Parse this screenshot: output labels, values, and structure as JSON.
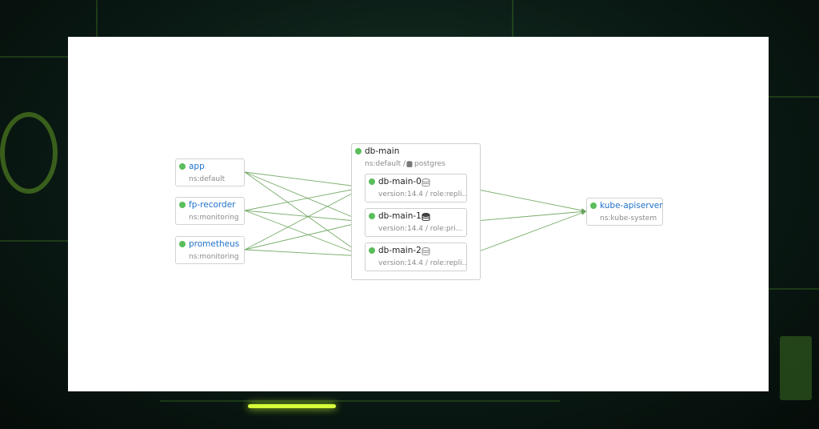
{
  "colors": {
    "status_ok": "#5bbd5b",
    "edge": "#6aa35a",
    "link_text": "#1f72c9"
  },
  "sources": [
    {
      "name": "app",
      "namespace": "ns:default"
    },
    {
      "name": "fp-recorder",
      "namespace": "ns:monitoring"
    },
    {
      "name": "prometheus",
      "namespace": "ns:monitoring"
    }
  ],
  "group": {
    "name": "db-main",
    "meta_ns": "ns:default /",
    "meta_app": "postgres",
    "members": [
      {
        "name": "db-main-0",
        "detail": "version:14.4 / role:repli...",
        "icon": "database-outline-icon"
      },
      {
        "name": "db-main-1",
        "detail": "version:14.4 / role:pri...",
        "icon": "database-primary-icon"
      },
      {
        "name": "db-main-2",
        "detail": "version:14.4 / role:repli...",
        "icon": "database-outline-icon"
      }
    ]
  },
  "target": {
    "name": "kube-apiserver",
    "namespace": "ns:kube-system"
  }
}
